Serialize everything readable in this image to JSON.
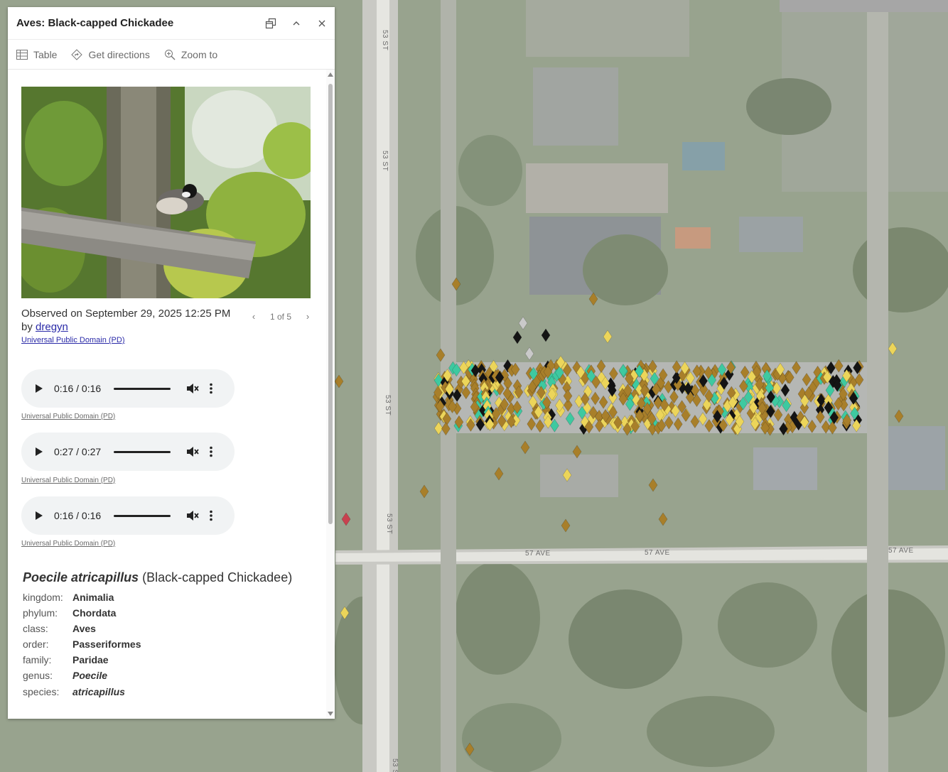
{
  "popup": {
    "title": "Aves: Black-capped Chickadee",
    "header_icons": [
      "dock-icon",
      "collapse-icon",
      "close-icon"
    ],
    "actions": [
      {
        "label": "Table",
        "icon": "table-icon"
      },
      {
        "label": "Get directions",
        "icon": "directions-icon"
      },
      {
        "label": "Zoom to",
        "icon": "zoom-to-icon"
      }
    ],
    "observation": {
      "prefix": "Observed on September 29, 2025 12:25 PM by ",
      "observer": "dregyn",
      "photo_license": "Universal Public Domain (PD)"
    },
    "pager": {
      "label": "1 of 5"
    },
    "audio": [
      {
        "time": "0:16 / 0:16",
        "license": "Universal Public Domain (PD)"
      },
      {
        "time": "0:27 / 0:27",
        "license": "Universal Public Domain (PD)"
      },
      {
        "time": "0:16 / 0:16",
        "license": "Universal Public Domain (PD)"
      }
    ],
    "taxon": {
      "scientific_name": "Poecile atricapillus",
      "common_name": "(Black-capped Chickadee)",
      "ranks": [
        {
          "rank": "kingdom:",
          "value": "Animalia",
          "italic": false
        },
        {
          "rank": "phylum:",
          "value": "Chordata",
          "italic": false
        },
        {
          "rank": "class:",
          "value": "Aves",
          "italic": false
        },
        {
          "rank": "order:",
          "value": "Passeriformes",
          "italic": false
        },
        {
          "rank": "family:",
          "value": "Paridae",
          "italic": false
        },
        {
          "rank": "genus:",
          "value": "Poecile",
          "italic": true
        },
        {
          "rank": "species:",
          "value": "atricapillus",
          "italic": true
        }
      ]
    }
  },
  "map": {
    "street_labels": {
      "st_1": "53 ST",
      "st_2": "53 ST",
      "st_3": "53 ST",
      "st_4": "53 ST",
      "st_5": "53 S",
      "ave_1": "57 AVE",
      "ave_2": "57 AVE",
      "ave_3": "57 AVE"
    },
    "marker_colors": {
      "brown": "#a87f2a",
      "yellow": "#ecd55a",
      "black": "#141414",
      "teal": "#3ec9a0",
      "gray": "#c9c9c9",
      "red": "#c8414f"
    }
  }
}
